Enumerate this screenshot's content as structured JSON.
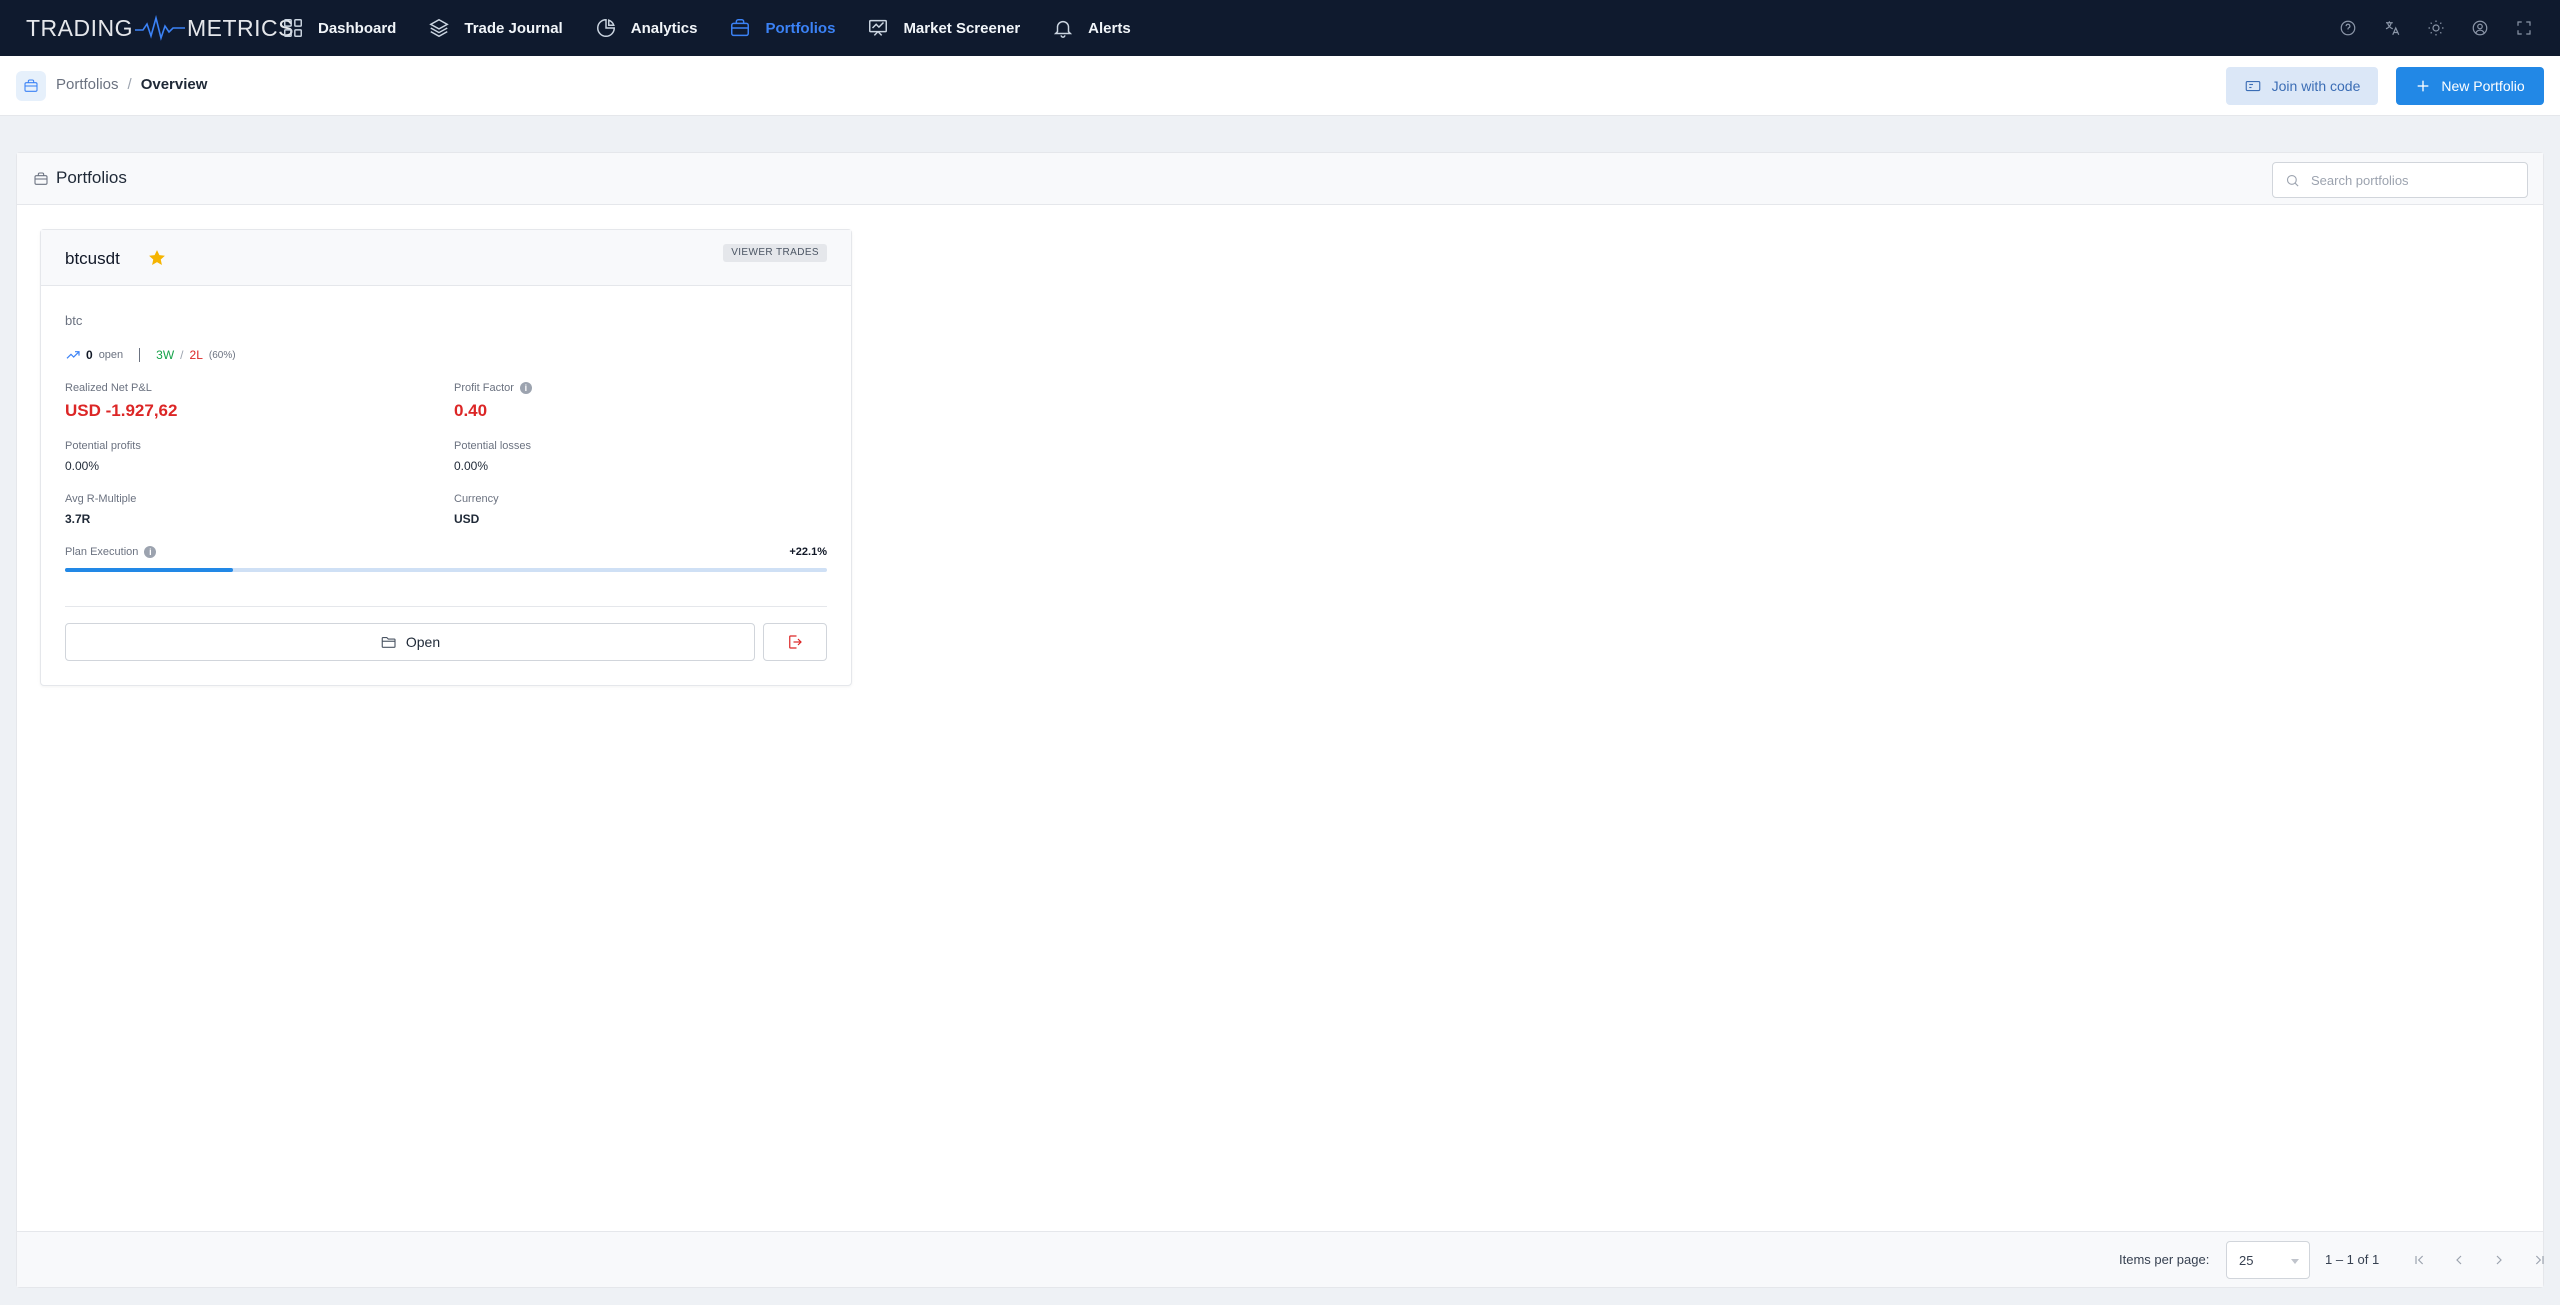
{
  "app": {
    "logo_left": "TRADING",
    "logo_right": "METRICS"
  },
  "nav": {
    "items": [
      {
        "label": "Dashboard",
        "icon": "grid-icon"
      },
      {
        "label": "Trade Journal",
        "icon": "layers-icon"
      },
      {
        "label": "Analytics",
        "icon": "pie-chart-icon"
      },
      {
        "label": "Portfolios",
        "icon": "briefcase-icon",
        "active": true
      },
      {
        "label": "Market Screener",
        "icon": "presentation-chart-icon"
      },
      {
        "label": "Alerts",
        "icon": "bell-icon"
      }
    ],
    "right_icons": [
      "help-icon",
      "translate-icon",
      "theme-sun-icon",
      "account-icon",
      "fullscreen-icon"
    ]
  },
  "breadcrumb": {
    "parent": "Portfolios",
    "separator": "/",
    "current": "Overview"
  },
  "actions": {
    "join_label": "Join with code",
    "new_label": "New Portfolio"
  },
  "panel": {
    "title": "Portfolios",
    "search_placeholder": "Search portfolios"
  },
  "portfolio": {
    "name": "btcusdt",
    "favorite": true,
    "badge": "VIEWER TRADES",
    "description": "btc",
    "open_count": "0",
    "open_label": "open",
    "wins": "3W",
    "losses": "2L",
    "win_rate": "(60%)",
    "realized_label": "Realized Net P&L",
    "realized_value": "USD -1.927,62",
    "profit_factor_label": "Profit Factor",
    "profit_factor_value": "0.40",
    "potential_profits_label": "Potential profits",
    "potential_profits_value": "0.00%",
    "potential_losses_label": "Potential losses",
    "potential_losses_value": "0.00%",
    "avg_r_label": "Avg R-Multiple",
    "avg_r_value": "3.7R",
    "currency_label": "Currency",
    "currency_value": "USD",
    "plan_label": "Plan Execution",
    "plan_value": "+22.1%",
    "plan_progress": 0.221,
    "open_button": "Open"
  },
  "paginator": {
    "items_label": "Items per page:",
    "page_size": "25",
    "range": "1 – 1 of 1"
  },
  "colors": {
    "nav_bg": "#0f1a2e",
    "accent": "#2288e6",
    "negative": "#dc2626",
    "positive": "#16a34a",
    "star": "#f5b400"
  }
}
